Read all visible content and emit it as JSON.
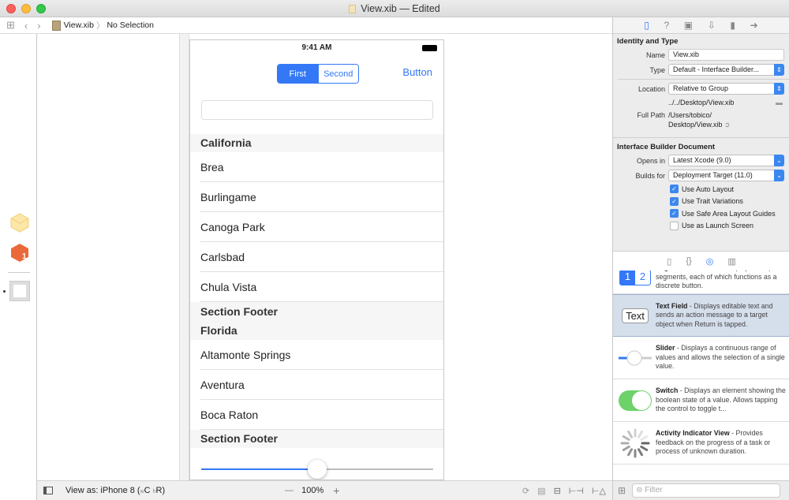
{
  "window": {
    "title": "View.xib — Edited"
  },
  "jumpbar": {
    "file": "View.xib",
    "selection": "No Selection"
  },
  "phone": {
    "status_time": "9:41 AM",
    "segments": [
      "First",
      "Second"
    ],
    "nav_button": "Button",
    "sections": [
      {
        "header": "California",
        "rows": [
          "Brea",
          "Burlingame",
          "Canoga Park",
          "Carlsbad",
          "Chula Vista"
        ],
        "footer": "Section Footer"
      },
      {
        "header": "Florida",
        "rows": [
          "Altamonte Springs",
          "Aventura",
          "Boca Raton"
        ],
        "footer": "Section Footer"
      }
    ],
    "slider_value": 0.5
  },
  "bottombar": {
    "view_as": "View as: iPhone 8 (",
    "w": "w",
    "c": "C ",
    "h": "h",
    "r": "R)",
    "zoom_out": "—",
    "zoom": "100%",
    "zoom_in": "+"
  },
  "inspector": {
    "identity": {
      "title": "Identity and Type",
      "name_label": "Name",
      "name_value": "View.xib",
      "type_label": "Type",
      "type_value": "Default - Interface Builder...",
      "location_label": "Location",
      "location_value": "Relative to Group",
      "relative_path": "../../Desktop/View.xib",
      "fullpath_label": "Full Path",
      "fullpath_line1": "/Users/tobico/",
      "fullpath_line2": "Desktop/View.xib"
    },
    "ibdoc": {
      "title": "Interface Builder Document",
      "opens_label": "Opens in",
      "opens_value": "Latest Xcode (9.0)",
      "builds_label": "Builds for",
      "builds_value": "Deployment Target (11.0)",
      "checks": [
        {
          "label": "Use Auto Layout",
          "checked": true
        },
        {
          "label": "Use Trait Variations",
          "checked": true
        },
        {
          "label": "Use Safe Area Layout Guides",
          "checked": true
        },
        {
          "label": "Use as Launch Screen",
          "checked": false
        }
      ]
    }
  },
  "library": {
    "items": [
      {
        "name": "Segmented Control",
        "desc": " - Displays multiple segments, each of which functions as a discrete button."
      },
      {
        "name": "Text Field",
        "desc": " - Displays editable text and sends an action message to a target object when Return is tapped.",
        "icon_text": "Text"
      },
      {
        "name": "Slider",
        "desc": " - Displays a continuous range of values and allows the selection of a single value."
      },
      {
        "name": "Switch",
        "desc": " - Displays an element showing the boolean state of a value. Allows tapping the control to toggle t..."
      },
      {
        "name": "Activity Indicator View",
        "desc": " - Provides feedback on the progress of a task or process of unknown duration."
      }
    ],
    "filter_placeholder": "Filter"
  }
}
